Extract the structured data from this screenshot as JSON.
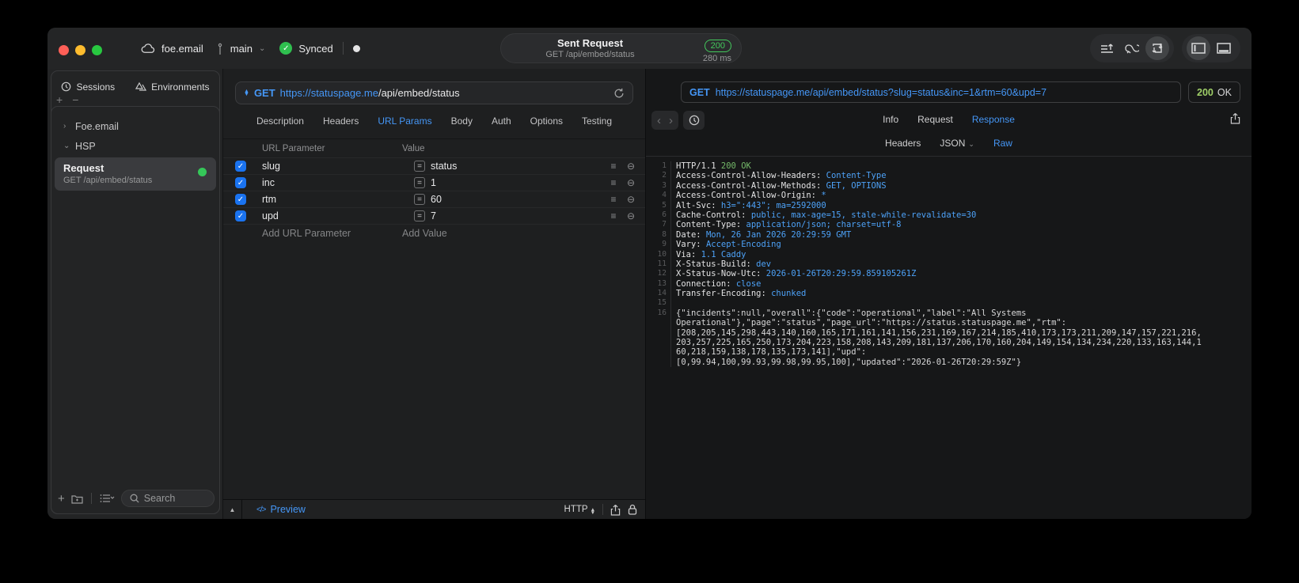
{
  "titlebar": {
    "project": "foe.email",
    "branch": "main",
    "sync_status": "Synced",
    "request": {
      "title": "Sent Request",
      "subtitle": "GET /api/embed/status",
      "status_code": "200",
      "duration": "280 ms"
    }
  },
  "sidebar": {
    "tabs": [
      {
        "label": "Sessions"
      },
      {
        "label": "Environments"
      }
    ],
    "tree": [
      {
        "label": "Foe.email"
      },
      {
        "label": "HSP"
      }
    ],
    "request_item": {
      "title": "Request",
      "subtitle": "GET /api/embed/status"
    },
    "search": {
      "placeholder": "Search"
    }
  },
  "request_panel": {
    "method": "GET",
    "url": {
      "host": "https://statuspage.me",
      "path": "/api/embed/status"
    },
    "tabs": [
      "Description",
      "Headers",
      "URL Params",
      "Body",
      "Auth",
      "Options",
      "Testing"
    ],
    "active_tab": "URL Params",
    "params": {
      "columns": [
        "URL Parameter",
        "Value"
      ],
      "rows": [
        {
          "name": "slug",
          "value": "status",
          "enabled": true
        },
        {
          "name": "inc",
          "value": "1",
          "enabled": true
        },
        {
          "name": "rtm",
          "value": "60",
          "enabled": true
        },
        {
          "name": "upd",
          "value": "7",
          "enabled": true
        }
      ],
      "add_name": "Add URL Parameter",
      "add_value": "Add Value"
    },
    "footer": {
      "preview": "Preview",
      "protocol": "HTTP"
    }
  },
  "response_panel": {
    "method": "GET",
    "url": "https://statuspage.me/api/embed/status?slug=status&inc=1&rtm=60&upd=7",
    "status_code": "200",
    "status_text": "OK",
    "tabs": [
      "Info",
      "Request",
      "Response"
    ],
    "active_tab": "Response",
    "subtabs": [
      "Headers",
      "JSON",
      "Raw"
    ],
    "active_subtab": "Raw",
    "raw_lines": [
      {
        "n": "1",
        "protocol": "HTTP/1.1",
        "status": "200 OK"
      },
      {
        "n": "2",
        "name": "Access-Control-Allow-Headers",
        "value": "Content-Type"
      },
      {
        "n": "3",
        "name": "Access-Control-Allow-Methods",
        "value": "GET, OPTIONS"
      },
      {
        "n": "4",
        "name": "Access-Control-Allow-Origin",
        "value": "*"
      },
      {
        "n": "5",
        "name": "Alt-Svc",
        "value": "h3=\":443\"; ma=2592000"
      },
      {
        "n": "6",
        "name": "Cache-Control",
        "value": "public, max-age=15, stale-while-revalidate=30"
      },
      {
        "n": "7",
        "name": "Content-Type",
        "value": "application/json; charset=utf-8"
      },
      {
        "n": "8",
        "name": "Date",
        "value": "Mon, 26 Jan 2026 20:29:59 GMT"
      },
      {
        "n": "9",
        "name": "Vary",
        "value": "Accept-Encoding"
      },
      {
        "n": "10",
        "name": "Via",
        "value": "1.1 Caddy"
      },
      {
        "n": "11",
        "name": "X-Status-Build",
        "value": "dev"
      },
      {
        "n": "12",
        "name": "X-Status-Now-Utc",
        "value": "2026-01-26T20:29:59.859105261Z"
      },
      {
        "n": "13",
        "name": "Connection",
        "value": "close"
      },
      {
        "n": "14",
        "name": "Transfer-Encoding",
        "value": "chunked"
      },
      {
        "n": "15",
        "body": ""
      },
      {
        "n": "16",
        "body": "{\"incidents\":null,\"overall\":{\"code\":\"operational\",\"label\":\"All Systems"
      },
      {
        "n": "",
        "body": "Operational\"},\"page\":\"status\",\"page_url\":\"https://status.statuspage.me\",\"rtm\":"
      },
      {
        "n": "",
        "body": "[208,205,145,298,443,140,160,165,171,161,141,156,231,169,167,214,185,410,173,173,211,209,147,157,221,216,"
      },
      {
        "n": "",
        "body": "203,257,225,165,250,173,204,223,158,208,143,209,181,137,206,170,160,204,149,154,134,234,220,133,163,144,1"
      },
      {
        "n": "",
        "body": "60,218,159,138,178,135,173,141],\"upd\":"
      },
      {
        "n": "",
        "body": "[0,99.94,100,99.93,99.98,99.95,100],\"updated\":\"2026-01-26T20:29:59Z\"}"
      }
    ]
  },
  "colors": {
    "accent_blue": "#4597f7",
    "value_blue": "#4da2f8",
    "green": "#32d74b",
    "raw_green": "#74b969",
    "status_green": "#9fcf68",
    "checkbox_blue": "#1a73f0"
  }
}
